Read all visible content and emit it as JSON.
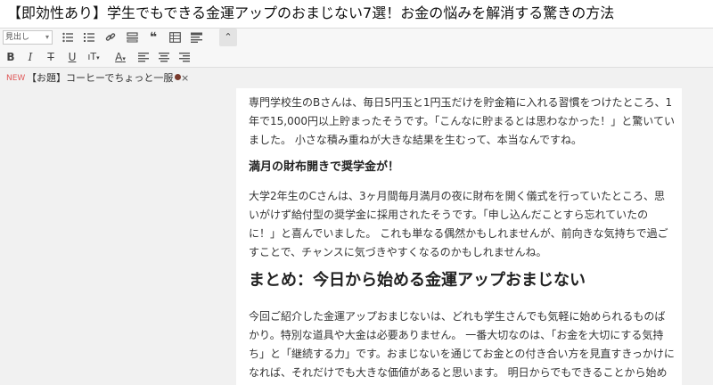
{
  "title": "【即効性あり】学生でもできる金運アップのおまじない7選！お金の悩みを解消する驚きの方法",
  "toolbar": {
    "format_select": "見出し",
    "icons": [
      "unordered-list-icon",
      "ordered-list-icon",
      "link-icon",
      "horizontal-rule-icon",
      "quote-icon",
      "table-icon",
      "paragraph-icon"
    ],
    "row2_icons": [
      "bold-icon",
      "italic-icon",
      "strikethrough-icon",
      "underline-icon",
      "font-size-icon",
      "text-color-icon",
      "align-left-icon",
      "align-center-icon",
      "align-right-icon"
    ]
  },
  "tag": {
    "badge": "NEW",
    "label": "【お題】コーヒーでちょっと一服",
    "close": "×"
  },
  "article": {
    "p1": "専門学校生のBさんは、毎日5円玉と1円玉だけを貯金箱に入れる習慣をつけたところ、1年で15,000円以上貯まったそうです。「こんなに貯まるとは思わなかった！」と驚いていました。 小さな積み重ねが大きな結果を生むって、本当なんですね。",
    "h3": "満月の財布開きで奨学金が！",
    "p2": "大学2年生のCさんは、3ヶ月間毎月満月の夜に財布を開く儀式を行っていたところ、思いがけず給付型の奨学金に採用されたそうです。「申し込んだことすら忘れていたのに！」と喜んでいました。 これも単なる偶然かもしれませんが、前向きな気持ちで過ごすことで、チャンスに気づきやすくなるのかもしれませんね。",
    "h2": "まとめ：今日から始める金運アップおまじない",
    "p3": "今回ご紹介した金運アップおまじないは、どれも学生さんでも気軽に始められるものばかり。特別な道具や大金は必要ありません。 一番大切なのは、「お金を大切にする気持ち」と「継続する力」です。おまじないを通じてお金との付き合い方を見直すきっかけになれば、それだけでも大きな価値があると思います。 明日からでもできることから始めてみませんか？財布の整理、小銭貯金、満月の儀式…。どれか一つでも習慣にしてみ"
  }
}
